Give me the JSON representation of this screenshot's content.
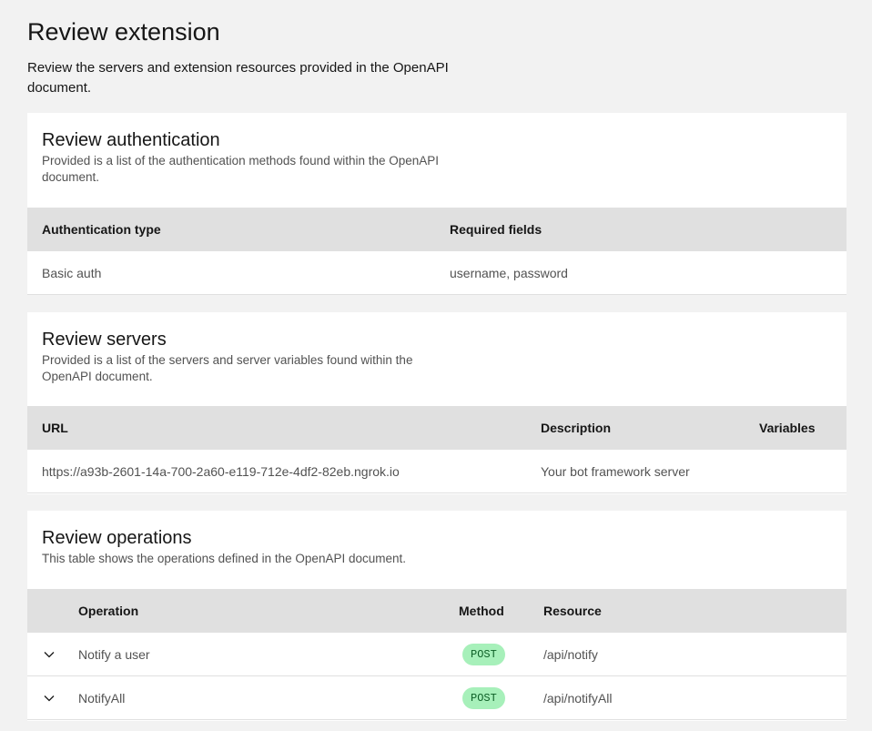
{
  "page": {
    "title": "Review extension",
    "description": "Review the servers and extension resources provided in the OpenAPI document."
  },
  "authentication": {
    "title": "Review authentication",
    "description": "Provided is a list of the authentication methods found within the OpenAPI document.",
    "columns": [
      "Authentication type",
      "Required fields"
    ],
    "rows": [
      {
        "type": "Basic auth",
        "fields": "username, password"
      }
    ]
  },
  "servers": {
    "title": "Review servers",
    "description": "Provided is a list of the servers and server variables found within the OpenAPI document.",
    "columns": [
      "URL",
      "Description",
      "Variables"
    ],
    "rows": [
      {
        "url": "https://a93b-2601-14a-700-2a60-e119-712e-4df2-82eb.ngrok.io",
        "description": "Your bot framework server",
        "variables": ""
      }
    ]
  },
  "operations": {
    "title": "Review operations",
    "description": "This table shows the operations defined in the OpenAPI document.",
    "columns": [
      "Operation",
      "Method",
      "Resource"
    ],
    "rows": [
      {
        "operation": "Notify a user",
        "method": "POST",
        "resource": "/api/notify",
        "expand_icon": "chevron-down-icon"
      },
      {
        "operation": "NotifyAll",
        "method": "POST",
        "resource": "/api/notifyAll",
        "expand_icon": "chevron-down-icon"
      }
    ]
  },
  "colors": {
    "background": "#f2f2f2",
    "tile": "#ffffff",
    "table_header": "#e0e0e0",
    "tag_bg": "#a7f0ba",
    "tag_text": "#0e6027"
  }
}
